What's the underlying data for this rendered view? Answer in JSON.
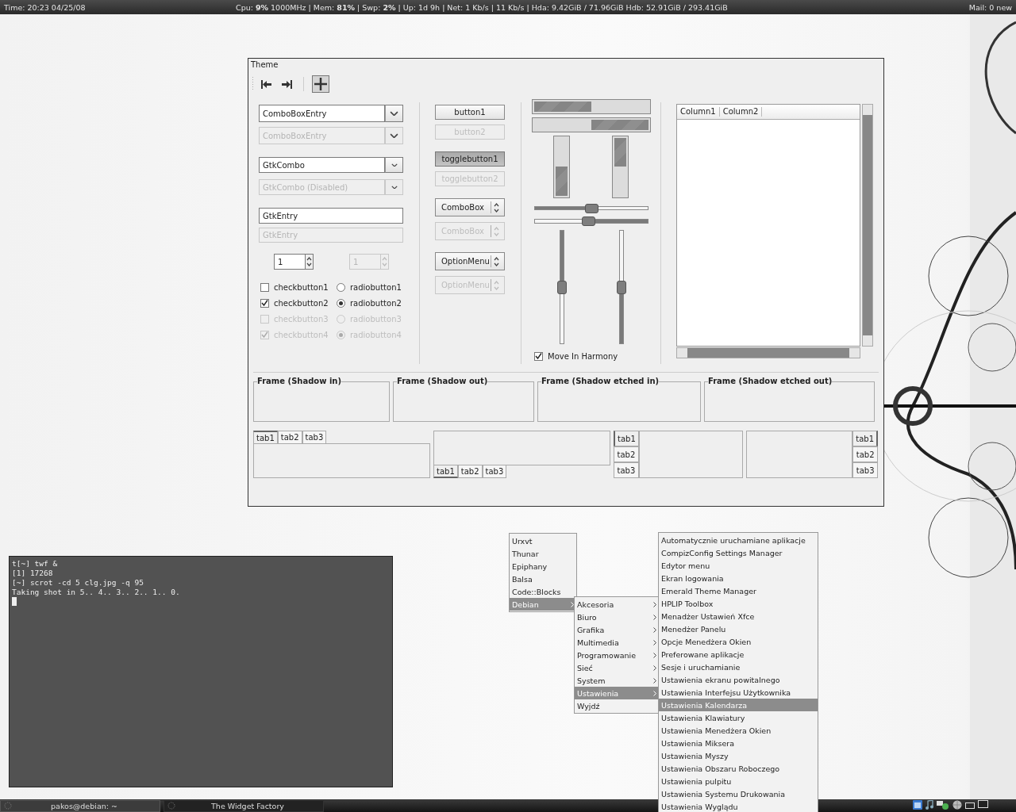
{
  "top_bar": {
    "time": "Time: 20:23 04/25/08",
    "stats": "Cpu: **9%** 1000MHz | Mem: **81%** | Swp: **2%** |  Up: 1d 9h  | Net: 1 Kb/s  |  11 Kb/s  | Hda: 9.42GiB / 71.96GiB   Hdb: 52.91GiB / 293.41GiB",
    "mail": "Mail: 0 new"
  },
  "widget_factory": {
    "title": "Theme",
    "toolbar": [
      {
        "kind": "back",
        "selected": false
      },
      {
        "kind": "forward",
        "selected": false
      },
      {
        "kind": "add",
        "selected": true
      }
    ],
    "combo_entries": [
      {
        "value": "ComboBoxEntry",
        "disabled": false
      },
      {
        "value": "ComboBoxEntry",
        "disabled": true
      }
    ],
    "gtk_combos": [
      {
        "value": "GtkCombo",
        "disabled": false
      },
      {
        "value": "GtkCombo (Disabled)",
        "disabled": true
      }
    ],
    "entries": [
      {
        "value": "GtkEntry",
        "disabled": false
      },
      {
        "value": "GtkEntry",
        "disabled": true
      }
    ],
    "spin_buttons": [
      {
        "value": "1",
        "disabled": false
      },
      {
        "value": "1",
        "disabled": true
      }
    ],
    "checkbuttons": [
      {
        "label": "checkbutton1",
        "checked": false,
        "disabled": false
      },
      {
        "label": "checkbutton2",
        "checked": true,
        "disabled": false
      },
      {
        "label": "checkbutton3",
        "checked": false,
        "disabled": true
      },
      {
        "label": "checkbutton4",
        "checked": true,
        "disabled": true
      }
    ],
    "radiobuttons": [
      {
        "label": "radiobutton1",
        "selected": false,
        "disabled": false
      },
      {
        "label": "radiobutton2",
        "selected": true,
        "disabled": false
      },
      {
        "label": "radiobutton3",
        "selected": false,
        "disabled": true
      },
      {
        "label": "radiobutton4",
        "selected": true,
        "disabled": true
      }
    ],
    "buttons": [
      {
        "label": "button1",
        "disabled": false
      },
      {
        "label": "button2",
        "disabled": true
      }
    ],
    "toggle_buttons": [
      {
        "label": "togglebutton1",
        "on": true,
        "disabled": false
      },
      {
        "label": "togglebutton2",
        "on": false,
        "disabled": true
      }
    ],
    "combo_boxes": [
      {
        "value": "ComboBox",
        "disabled": false
      },
      {
        "value": "ComboBox",
        "disabled": true
      }
    ],
    "option_menus": [
      {
        "value": "OptionMenu",
        "disabled": false
      },
      {
        "value": "OptionMenu",
        "disabled": true
      }
    ],
    "horizontal_progress": [
      {
        "level": 0.5,
        "inverted": false
      },
      {
        "level": 0.5,
        "inverted": true
      }
    ],
    "vertical_progress": [
      {
        "level": 0.5,
        "inverted": false
      },
      {
        "level": 0.5,
        "inverted": true
      }
    ],
    "horizontal_scales": [
      {
        "level": 0.5,
        "inverted": false
      },
      {
        "level": 0.47,
        "inverted": true
      }
    ],
    "vertical_scales": [
      {
        "level": 0.5,
        "inverted": true
      },
      {
        "level": 0.5,
        "inverted": false
      }
    ],
    "move_in_harmony": {
      "label": "Move In Harmony",
      "checked": true
    },
    "tree": {
      "columns": [
        "Column1",
        "Column2"
      ]
    },
    "frames": [
      {
        "label": "Frame (Shadow in)"
      },
      {
        "label": "Frame (Shadow out)"
      },
      {
        "label": "Frame (Shadow etched in)"
      },
      {
        "label": "Frame (Shadow etched out)"
      }
    ],
    "notebooks": [
      {
        "kind": "top",
        "tabs": [
          {
            "label": "tab1",
            "selected": true
          },
          {
            "label": "tab2",
            "selected": false
          },
          {
            "label": "tab3",
            "selected": false
          }
        ]
      },
      {
        "kind": "bottom",
        "tabs": [
          {
            "label": "tab1",
            "selected": true
          },
          {
            "label": "tab2",
            "selected": false
          },
          {
            "label": "tab3",
            "selected": false
          }
        ]
      },
      {
        "kind": "left",
        "tabs": [
          {
            "label": "tab1",
            "selected": true
          },
          {
            "label": "tab2",
            "selected": false
          },
          {
            "label": "tab3",
            "selected": false
          }
        ]
      },
      {
        "kind": "right",
        "tabs": [
          {
            "label": "tab1",
            "selected": true
          },
          {
            "label": "tab2",
            "selected": false
          },
          {
            "label": "tab3",
            "selected": false
          }
        ]
      }
    ]
  },
  "terminal": {
    "lines": [
      "t[~] twf &",
      "[1] 17268",
      "[~] scrot -cd 5 clg.jpg -q 95",
      "Taking shot in 5.. 4.. 3.. 2.. 1.. 0."
    ]
  },
  "menus": [
    {
      "items": [
        {
          "label": "Urxvt",
          "selected": false,
          "submenu": false
        },
        {
          "label": "Thunar",
          "selected": false,
          "submenu": false
        },
        {
          "label": "Epiphany",
          "selected": false,
          "submenu": false
        },
        {
          "label": "Balsa",
          "selected": false,
          "submenu": false
        },
        {
          "label": "Code::Blocks",
          "selected": false,
          "submenu": false
        },
        {
          "label": "Debian",
          "selected": true,
          "submenu": true
        }
      ]
    },
    {
      "items": [
        {
          "label": "Akcesoria",
          "selected": false,
          "submenu": true
        },
        {
          "label": "Biuro",
          "selected": false,
          "submenu": true
        },
        {
          "label": "Grafika",
          "selected": false,
          "submenu": true
        },
        {
          "label": "Multimedia",
          "selected": false,
          "submenu": true
        },
        {
          "label": "Programowanie",
          "selected": false,
          "submenu": true
        },
        {
          "label": "Sieć",
          "selected": false,
          "submenu": true
        },
        {
          "label": "System",
          "selected": false,
          "submenu": true
        },
        {
          "label": "Ustawienia",
          "selected": true,
          "submenu": true
        },
        {
          "label": "Wyjdź",
          "selected": false,
          "submenu": false
        }
      ]
    },
    {
      "items": [
        {
          "label": "Automatycznie uruchamiane aplikacje",
          "selected": false,
          "submenu": false
        },
        {
          "label": "CompizConfig Settings Manager",
          "selected": false,
          "submenu": false
        },
        {
          "label": "Edytor menu",
          "selected": false,
          "submenu": false
        },
        {
          "label": "Ekran logowania",
          "selected": false,
          "submenu": false
        },
        {
          "label": "Emerald Theme Manager",
          "selected": false,
          "submenu": false
        },
        {
          "label": "HPLIP Toolbox",
          "selected": false,
          "submenu": false
        },
        {
          "label": "Menadżer Ustawień Xfce",
          "selected": false,
          "submenu": false
        },
        {
          "label": "Menedżer Panelu",
          "selected": false,
          "submenu": false
        },
        {
          "label": "Opcje Menedżera Okien",
          "selected": false,
          "submenu": false
        },
        {
          "label": "Preferowane aplikacje",
          "selected": false,
          "submenu": false
        },
        {
          "label": "Sesje i uruchamianie",
          "selected": false,
          "submenu": false
        },
        {
          "label": "Ustawienia ekranu powitalnego",
          "selected": false,
          "submenu": false
        },
        {
          "label": "Ustawienia Interfejsu Użytkownika",
          "selected": false,
          "submenu": false
        },
        {
          "label": "Ustawienia Kalendarza",
          "selected": true,
          "submenu": false
        },
        {
          "label": "Ustawienia Klawiatury",
          "selected": false,
          "submenu": false
        },
        {
          "label": "Ustawienia Menedżera Okien",
          "selected": false,
          "submenu": false
        },
        {
          "label": "Ustawienia Miksera",
          "selected": false,
          "submenu": false
        },
        {
          "label": "Ustawienia Myszy",
          "selected": false,
          "submenu": false
        },
        {
          "label": "Ustawienia Obszaru Roboczego",
          "selected": false,
          "submenu": false
        },
        {
          "label": "Ustawienia pulpitu",
          "selected": false,
          "submenu": false
        },
        {
          "label": "Ustawienia Systemu Drukowania",
          "selected": false,
          "submenu": false
        },
        {
          "label": "Ustawienia Wyglądu",
          "selected": false,
          "submenu": false
        }
      ]
    }
  ],
  "taskbar": {
    "tasks": [
      {
        "label": "pakos@debian: ~",
        "selected": true
      },
      {
        "label": "The Widget Factory",
        "selected": false
      }
    ]
  }
}
